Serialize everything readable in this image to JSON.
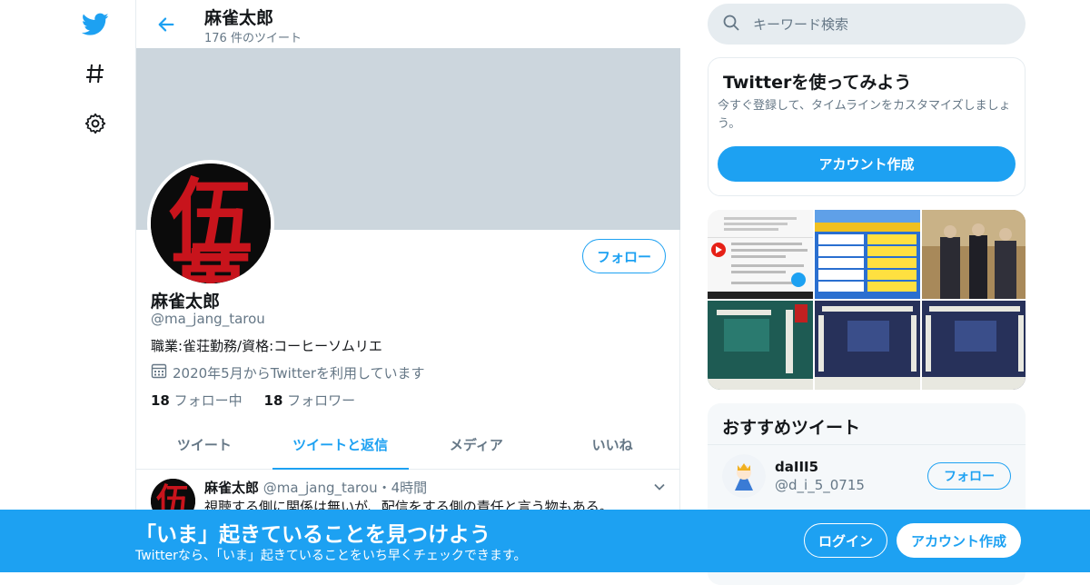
{
  "header": {
    "name": "麻雀太郎",
    "tweet_count": "176 件のツイート"
  },
  "profile": {
    "name": "麻雀太郎",
    "handle": "@ma_jang_tarou",
    "bio": "職業:雀荘勤務/資格:コーヒーソムリエ",
    "joined": "2020年5月からTwitterを利用しています",
    "following_count": "18",
    "following_label": "フォロー中",
    "followers_count": "18",
    "followers_label": "フォロワー",
    "follow_label": "フォロー",
    "avatar_glyph_top": "伍",
    "avatar_glyph_bottom": "萬"
  },
  "tabs": [
    {
      "label": "ツイート"
    },
    {
      "label": "ツイートと返信"
    },
    {
      "label": "メディア"
    },
    {
      "label": "いいね"
    }
  ],
  "tweet": {
    "name": "麻雀太郎",
    "handle": "@ma_jang_tarou",
    "time": "・4時間",
    "text": "視聴する側に関係は無いが、配信をする側の責任と言う物もある。"
  },
  "search": {
    "placeholder": "キーワード検索"
  },
  "signup_box": {
    "title": "Twitterを使ってみよう",
    "desc": "今すぐ登録して、タイムラインをカスタマイズしましょう。",
    "button": "アカウント作成"
  },
  "recommended": {
    "title": "おすすめツイート",
    "name": "daIII5",
    "handle": "@d_i_5_0715",
    "follow_label": "フォロー"
  },
  "bottom_bar": {
    "title": "「いま」起きていることを見つけよう",
    "subtitle": "Twitterなら、「いま」起きていることをいち早くチェックできます。",
    "login": "ログイン",
    "create": "アカウント作成"
  },
  "colors": {
    "accent": "#1da1f2",
    "banner": "#ccd6dd",
    "muted": "#657786"
  }
}
